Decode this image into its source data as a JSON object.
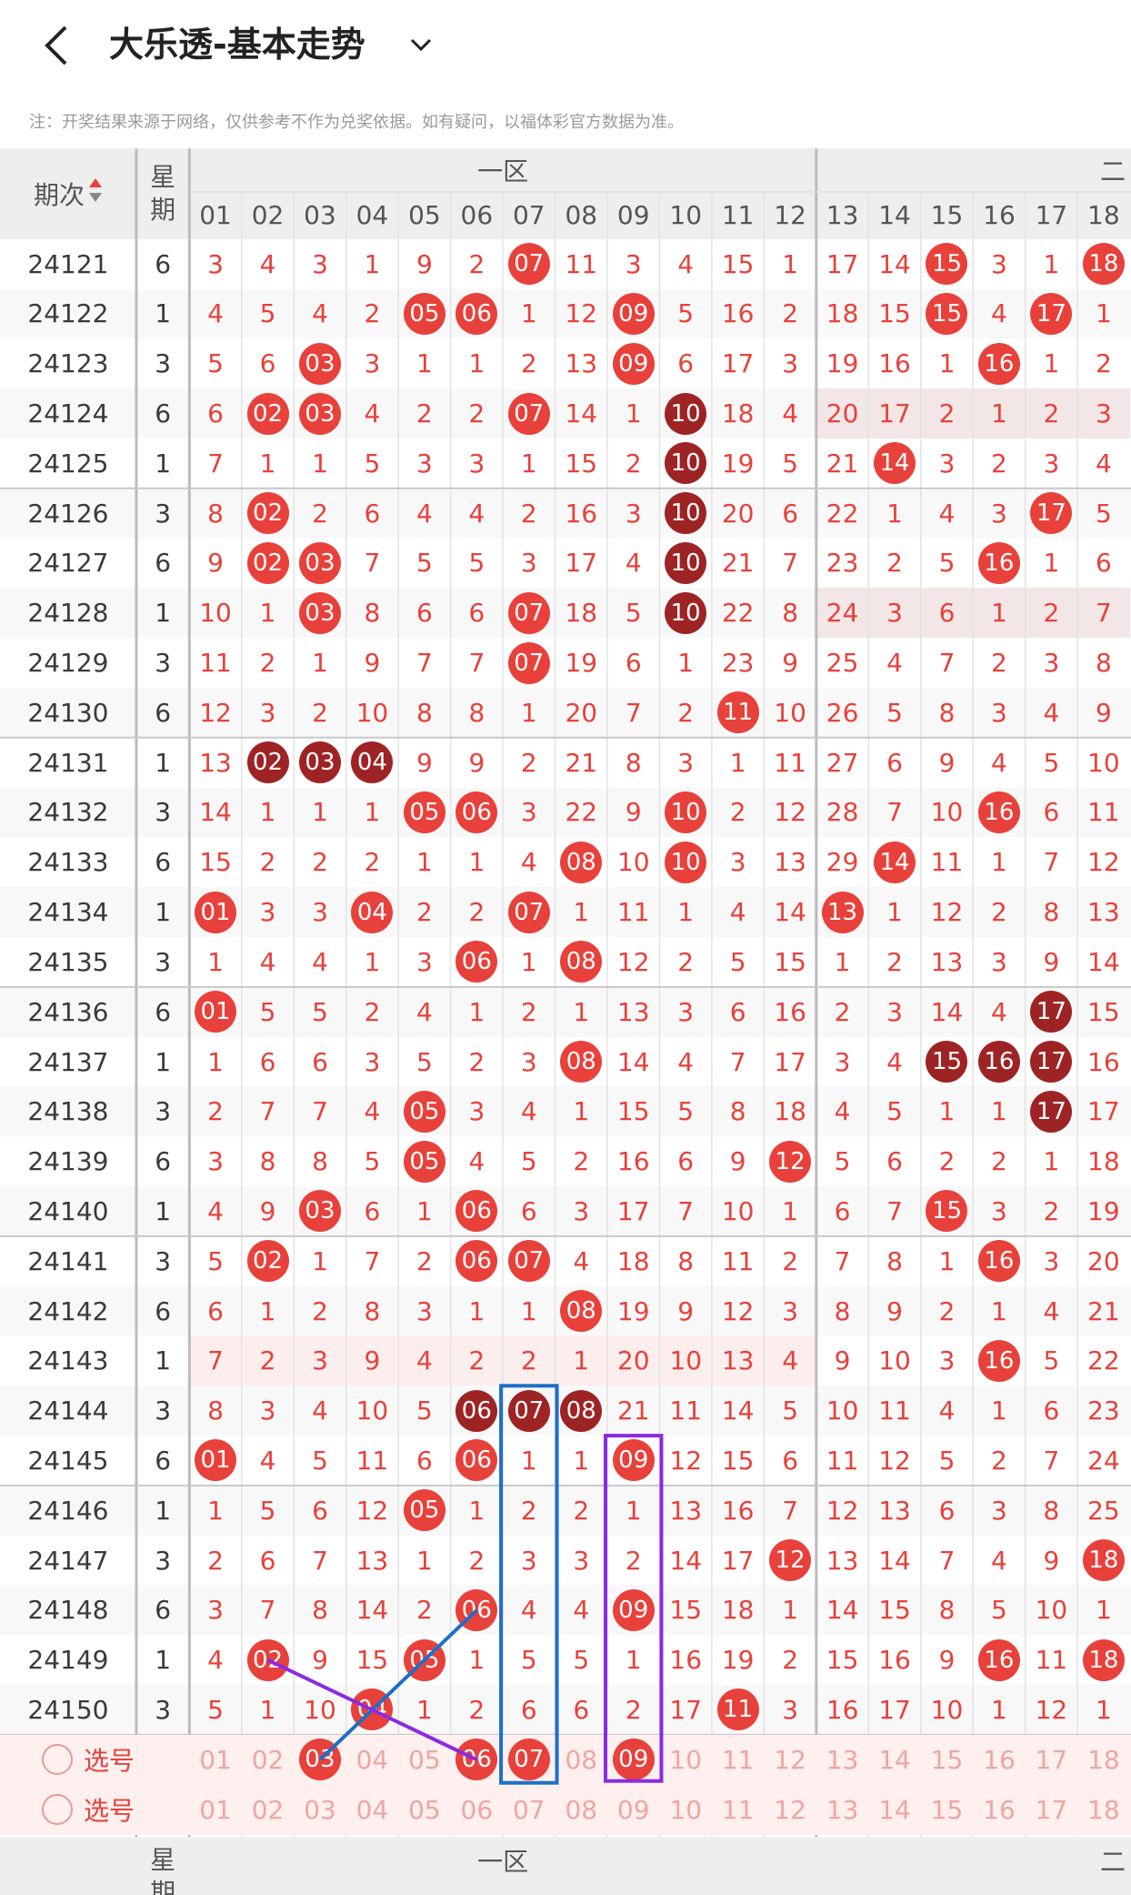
{
  "nav": {
    "title": "大乐透-基本走势",
    "back_icon": "chevron-left-icon",
    "dropdown_icon": "chevron-down-icon"
  },
  "notice": "注：开奖结果来源于网络，仅供参考不作为兑奖依据。如有疑问，以福体彩官方数据为准。",
  "header": {
    "issue_label": "期次",
    "week_label_top": "星",
    "week_label_bottom": "期",
    "zone1_label": "一区",
    "zone2_label": "二",
    "columns": [
      "01",
      "02",
      "03",
      "04",
      "05",
      "06",
      "07",
      "08",
      "09",
      "10",
      "11",
      "12",
      "13",
      "14",
      "15",
      "16",
      "17",
      "18"
    ]
  },
  "colors": {
    "red": "#e8413b",
    "dark": "#9e2325",
    "blue_box": "#1e6fc8",
    "purple_box": "#8a2be2"
  },
  "rows": [
    {
      "issue": "24121",
      "week": "6",
      "cells": [
        "3",
        "4",
        "3",
        "1",
        "9",
        "2",
        "07",
        "11",
        "3",
        "4",
        "15",
        "1",
        "17",
        "14",
        "15",
        "3",
        "1",
        "18"
      ],
      "balls": {
        "7": "r",
        "15": "r",
        "18": "r"
      }
    },
    {
      "issue": "24122",
      "week": "1",
      "cells": [
        "4",
        "5",
        "4",
        "2",
        "05",
        "06",
        "1",
        "12",
        "09",
        "5",
        "16",
        "2",
        "18",
        "15",
        "15",
        "4",
        "17",
        "1"
      ],
      "balls": {
        "5": "r",
        "6": "r",
        "9": "r",
        "15": "r",
        "17": "r"
      }
    },
    {
      "issue": "24123",
      "week": "3",
      "cells": [
        "5",
        "6",
        "03",
        "3",
        "1",
        "1",
        "2",
        "13",
        "09",
        "6",
        "17",
        "3",
        "19",
        "16",
        "1",
        "16",
        "1",
        "2"
      ],
      "balls": {
        "3": "r",
        "9": "r",
        "16": "r"
      }
    },
    {
      "issue": "24124",
      "week": "6",
      "cells": [
        "6",
        "02",
        "03",
        "4",
        "2",
        "2",
        "07",
        "14",
        "1",
        "10",
        "18",
        "4",
        "20",
        "17",
        "2",
        "1",
        "2",
        "3"
      ],
      "balls": {
        "2": "r",
        "3": "r",
        "7": "r",
        "10": "d"
      }
    },
    {
      "issue": "24125",
      "week": "1",
      "cells": [
        "7",
        "1",
        "1",
        "5",
        "3",
        "3",
        "1",
        "15",
        "2",
        "10",
        "19",
        "5",
        "21",
        "14",
        "3",
        "2",
        "3",
        "4"
      ],
      "balls": {
        "10": "d",
        "14": "r"
      }
    },
    {
      "issue": "24126",
      "week": "3",
      "cells": [
        "8",
        "02",
        "2",
        "6",
        "4",
        "4",
        "2",
        "16",
        "3",
        "10",
        "20",
        "6",
        "22",
        "1",
        "4",
        "3",
        "17",
        "5"
      ],
      "balls": {
        "2": "r",
        "10": "d",
        "17": "r"
      }
    },
    {
      "issue": "24127",
      "week": "6",
      "cells": [
        "9",
        "02",
        "03",
        "7",
        "5",
        "5",
        "3",
        "17",
        "4",
        "10",
        "21",
        "7",
        "23",
        "2",
        "5",
        "16",
        "1",
        "6"
      ],
      "balls": {
        "2": "r",
        "3": "r",
        "10": "d",
        "16": "r"
      }
    },
    {
      "issue": "24128",
      "week": "1",
      "cells": [
        "10",
        "1",
        "03",
        "8",
        "6",
        "6",
        "07",
        "18",
        "5",
        "10",
        "22",
        "8",
        "24",
        "3",
        "6",
        "1",
        "2",
        "7"
      ],
      "balls": {
        "3": "r",
        "7": "r",
        "10": "d"
      }
    },
    {
      "issue": "24129",
      "week": "3",
      "cells": [
        "11",
        "2",
        "1",
        "9",
        "7",
        "7",
        "07",
        "19",
        "6",
        "1",
        "23",
        "9",
        "25",
        "4",
        "7",
        "2",
        "3",
        "8"
      ],
      "balls": {
        "7": "r"
      }
    },
    {
      "issue": "24130",
      "week": "6",
      "cells": [
        "12",
        "3",
        "2",
        "10",
        "8",
        "8",
        "1",
        "20",
        "7",
        "2",
        "11",
        "10",
        "26",
        "5",
        "8",
        "3",
        "4",
        "9"
      ],
      "balls": {
        "11": "r"
      }
    },
    {
      "issue": "24131",
      "week": "1",
      "cells": [
        "13",
        "02",
        "03",
        "04",
        "9",
        "9",
        "2",
        "21",
        "8",
        "3",
        "1",
        "11",
        "27",
        "6",
        "9",
        "4",
        "5",
        "10"
      ],
      "balls": {
        "2": "d",
        "3": "d",
        "4": "d"
      }
    },
    {
      "issue": "24132",
      "week": "3",
      "cells": [
        "14",
        "1",
        "1",
        "1",
        "05",
        "06",
        "3",
        "22",
        "9",
        "10",
        "2",
        "12",
        "28",
        "7",
        "10",
        "16",
        "6",
        "11"
      ],
      "balls": {
        "5": "r",
        "6": "r",
        "10": "r",
        "16": "r"
      }
    },
    {
      "issue": "24133",
      "week": "6",
      "cells": [
        "15",
        "2",
        "2",
        "2",
        "1",
        "1",
        "4",
        "08",
        "10",
        "10",
        "3",
        "13",
        "29",
        "14",
        "11",
        "1",
        "7",
        "12"
      ],
      "balls": {
        "8": "r",
        "10": "r",
        "14": "r"
      }
    },
    {
      "issue": "24134",
      "week": "1",
      "cells": [
        "01",
        "3",
        "3",
        "04",
        "2",
        "2",
        "07",
        "1",
        "11",
        "1",
        "4",
        "14",
        "13",
        "1",
        "12",
        "2",
        "8",
        "13"
      ],
      "balls": {
        "1": "r",
        "4": "r",
        "7": "r",
        "13": "r"
      }
    },
    {
      "issue": "24135",
      "week": "3",
      "cells": [
        "1",
        "4",
        "4",
        "1",
        "3",
        "06",
        "1",
        "08",
        "12",
        "2",
        "5",
        "15",
        "1",
        "2",
        "13",
        "3",
        "9",
        "14"
      ],
      "balls": {
        "6": "r",
        "8": "r"
      }
    },
    {
      "issue": "24136",
      "week": "6",
      "cells": [
        "01",
        "5",
        "5",
        "2",
        "4",
        "1",
        "2",
        "1",
        "13",
        "3",
        "6",
        "16",
        "2",
        "3",
        "14",
        "4",
        "17",
        "15"
      ],
      "balls": {
        "1": "r",
        "17": "d"
      }
    },
    {
      "issue": "24137",
      "week": "1",
      "cells": [
        "1",
        "6",
        "6",
        "3",
        "5",
        "2",
        "3",
        "08",
        "14",
        "4",
        "7",
        "17",
        "3",
        "4",
        "15",
        "16",
        "17",
        "16"
      ],
      "balls": {
        "8": "r",
        "15": "d",
        "16": "d",
        "17": "d"
      }
    },
    {
      "issue": "24138",
      "week": "3",
      "cells": [
        "2",
        "7",
        "7",
        "4",
        "05",
        "3",
        "4",
        "1",
        "15",
        "5",
        "8",
        "18",
        "4",
        "5",
        "1",
        "1",
        "17",
        "17"
      ],
      "balls": {
        "5": "r",
        "17": "d"
      }
    },
    {
      "issue": "24139",
      "week": "6",
      "cells": [
        "3",
        "8",
        "8",
        "5",
        "05",
        "4",
        "5",
        "2",
        "16",
        "6",
        "9",
        "12",
        "5",
        "6",
        "2",
        "2",
        "1",
        "18"
      ],
      "balls": {
        "5": "r",
        "12": "r"
      }
    },
    {
      "issue": "24140",
      "week": "1",
      "cells": [
        "4",
        "9",
        "03",
        "6",
        "1",
        "06",
        "6",
        "3",
        "17",
        "7",
        "10",
        "1",
        "6",
        "7",
        "15",
        "3",
        "2",
        "19"
      ],
      "balls": {
        "3": "r",
        "6": "r",
        "15": "r"
      }
    },
    {
      "issue": "24141",
      "week": "3",
      "cells": [
        "5",
        "02",
        "1",
        "7",
        "2",
        "06",
        "07",
        "4",
        "18",
        "8",
        "11",
        "2",
        "7",
        "8",
        "1",
        "16",
        "3",
        "20"
      ],
      "balls": {
        "2": "r",
        "6": "r",
        "7": "r",
        "16": "r"
      }
    },
    {
      "issue": "24142",
      "week": "6",
      "cells": [
        "6",
        "1",
        "2",
        "8",
        "3",
        "1",
        "1",
        "08",
        "19",
        "9",
        "12",
        "3",
        "8",
        "9",
        "2",
        "1",
        "4",
        "21"
      ],
      "balls": {
        "8": "r"
      }
    },
    {
      "issue": "24143",
      "week": "1",
      "cells": [
        "7",
        "2",
        "3",
        "9",
        "4",
        "2",
        "2",
        "1",
        "20",
        "10",
        "13",
        "4",
        "9",
        "10",
        "3",
        "16",
        "5",
        "22"
      ],
      "balls": {
        "16": "r"
      }
    },
    {
      "issue": "24144",
      "week": "3",
      "cells": [
        "8",
        "3",
        "4",
        "10",
        "5",
        "06",
        "07",
        "08",
        "21",
        "11",
        "14",
        "5",
        "10",
        "11",
        "4",
        "1",
        "6",
        "23"
      ],
      "balls": {
        "6": "d",
        "7": "d",
        "8": "d"
      }
    },
    {
      "issue": "24145",
      "week": "6",
      "cells": [
        "01",
        "4",
        "5",
        "11",
        "6",
        "06",
        "1",
        "1",
        "09",
        "12",
        "15",
        "6",
        "11",
        "12",
        "5",
        "2",
        "7",
        "24"
      ],
      "balls": {
        "1": "r",
        "6": "r",
        "9": "r"
      }
    },
    {
      "issue": "24146",
      "week": "1",
      "cells": [
        "1",
        "5",
        "6",
        "12",
        "05",
        "1",
        "2",
        "2",
        "1",
        "13",
        "16",
        "7",
        "12",
        "13",
        "6",
        "3",
        "8",
        "25"
      ],
      "balls": {
        "5": "r"
      }
    },
    {
      "issue": "24147",
      "week": "3",
      "cells": [
        "2",
        "6",
        "7",
        "13",
        "1",
        "2",
        "3",
        "3",
        "2",
        "14",
        "17",
        "12",
        "13",
        "14",
        "7",
        "4",
        "9",
        "18"
      ],
      "balls": {
        "12": "r",
        "18": "r"
      }
    },
    {
      "issue": "24148",
      "week": "6",
      "cells": [
        "3",
        "7",
        "8",
        "14",
        "2",
        "06",
        "4",
        "4",
        "09",
        "15",
        "18",
        "1",
        "14",
        "15",
        "8",
        "5",
        "10",
        "1"
      ],
      "balls": {
        "6": "r",
        "9": "r"
      }
    },
    {
      "issue": "24149",
      "week": "1",
      "cells": [
        "4",
        "02",
        "9",
        "15",
        "05",
        "1",
        "5",
        "5",
        "1",
        "16",
        "19",
        "2",
        "15",
        "16",
        "9",
        "16",
        "11",
        "18"
      ],
      "balls": {
        "2": "r",
        "5": "r",
        "16": "r",
        "18": "r"
      }
    },
    {
      "issue": "24150",
      "week": "3",
      "cells": [
        "5",
        "1",
        "10",
        "04",
        "1",
        "2",
        "6",
        "6",
        "2",
        "17",
        "11",
        "3",
        "16",
        "17",
        "10",
        "1",
        "12",
        "1"
      ],
      "balls": {
        "4": "r",
        "11": "r"
      }
    }
  ],
  "select_rows": [
    {
      "label": "选号",
      "balls": {
        "3": "r",
        "6": "r",
        "7": "r",
        "9": "r"
      }
    },
    {
      "label": "选号",
      "balls": {}
    }
  ]
}
